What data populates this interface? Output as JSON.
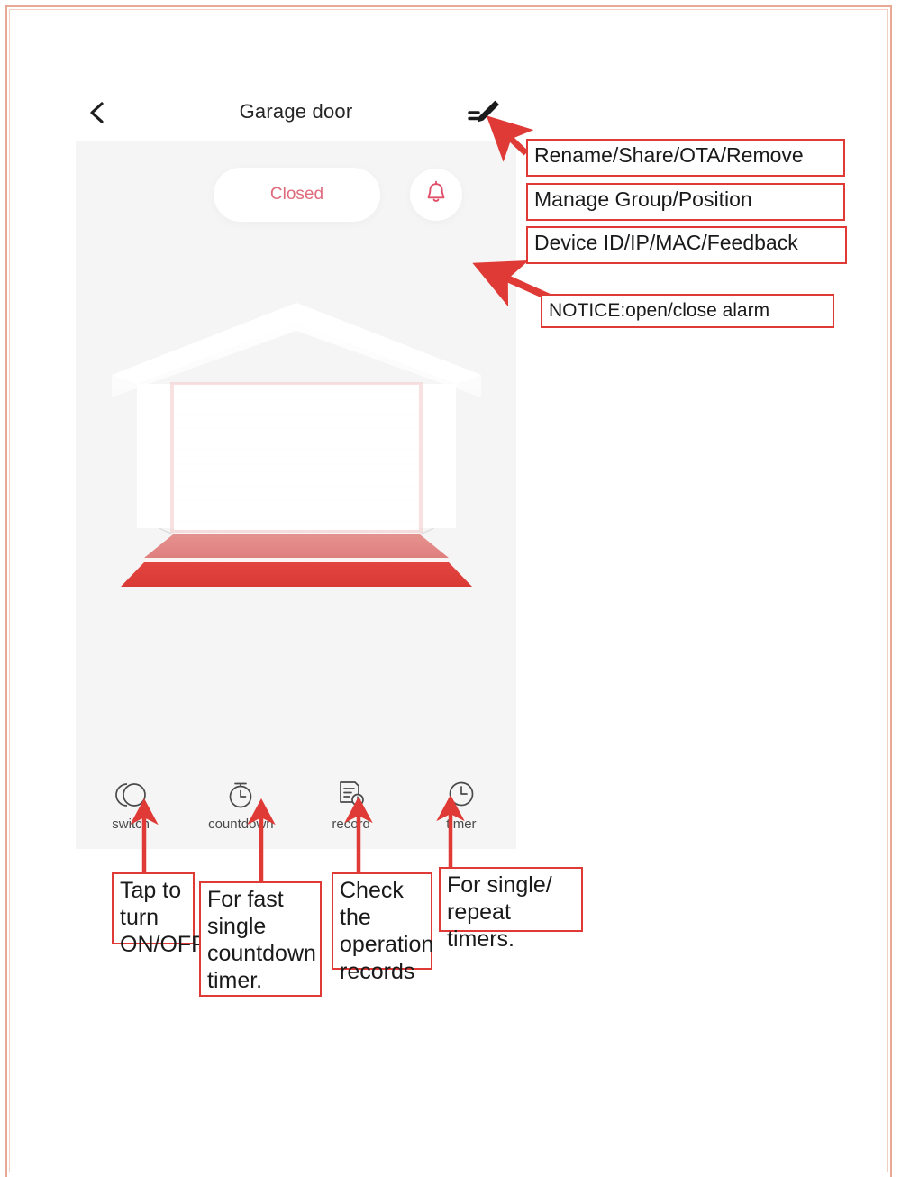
{
  "app": {
    "title": "Garage door",
    "back_icon": "chevron-left-icon",
    "edit_icon": "pencil-edit-icon",
    "status_label": "Closed",
    "alarm_icon": "bell-icon",
    "illustration": "closed-garage-door"
  },
  "actions": [
    {
      "id": "switch",
      "label": "switch",
      "icon": "two-circles-switch-icon"
    },
    {
      "id": "countdown",
      "label": "countdown",
      "icon": "stopwatch-icon"
    },
    {
      "id": "record",
      "label": "record",
      "icon": "document-clock-icon"
    },
    {
      "id": "timer",
      "label": "timer",
      "icon": "clock-icon"
    }
  ],
  "annotations": {
    "edit_menu": [
      "Rename/Share/OTA/Remove",
      "Manage Group/Position",
      "Device ID/IP/MAC/Feedback"
    ],
    "notice": "NOTICE:open/close alarm",
    "switch": "Tap to turn ON/OFF.",
    "countdown": "For fast single countdown timer.",
    "record": "Check the operation records",
    "timer": "For single/ repeat timers."
  },
  "colors": {
    "accent_red": "#e03a36",
    "status_text": "#e06a7c",
    "screen_bg": "#f5f5f5",
    "frame": "#e8a893"
  }
}
